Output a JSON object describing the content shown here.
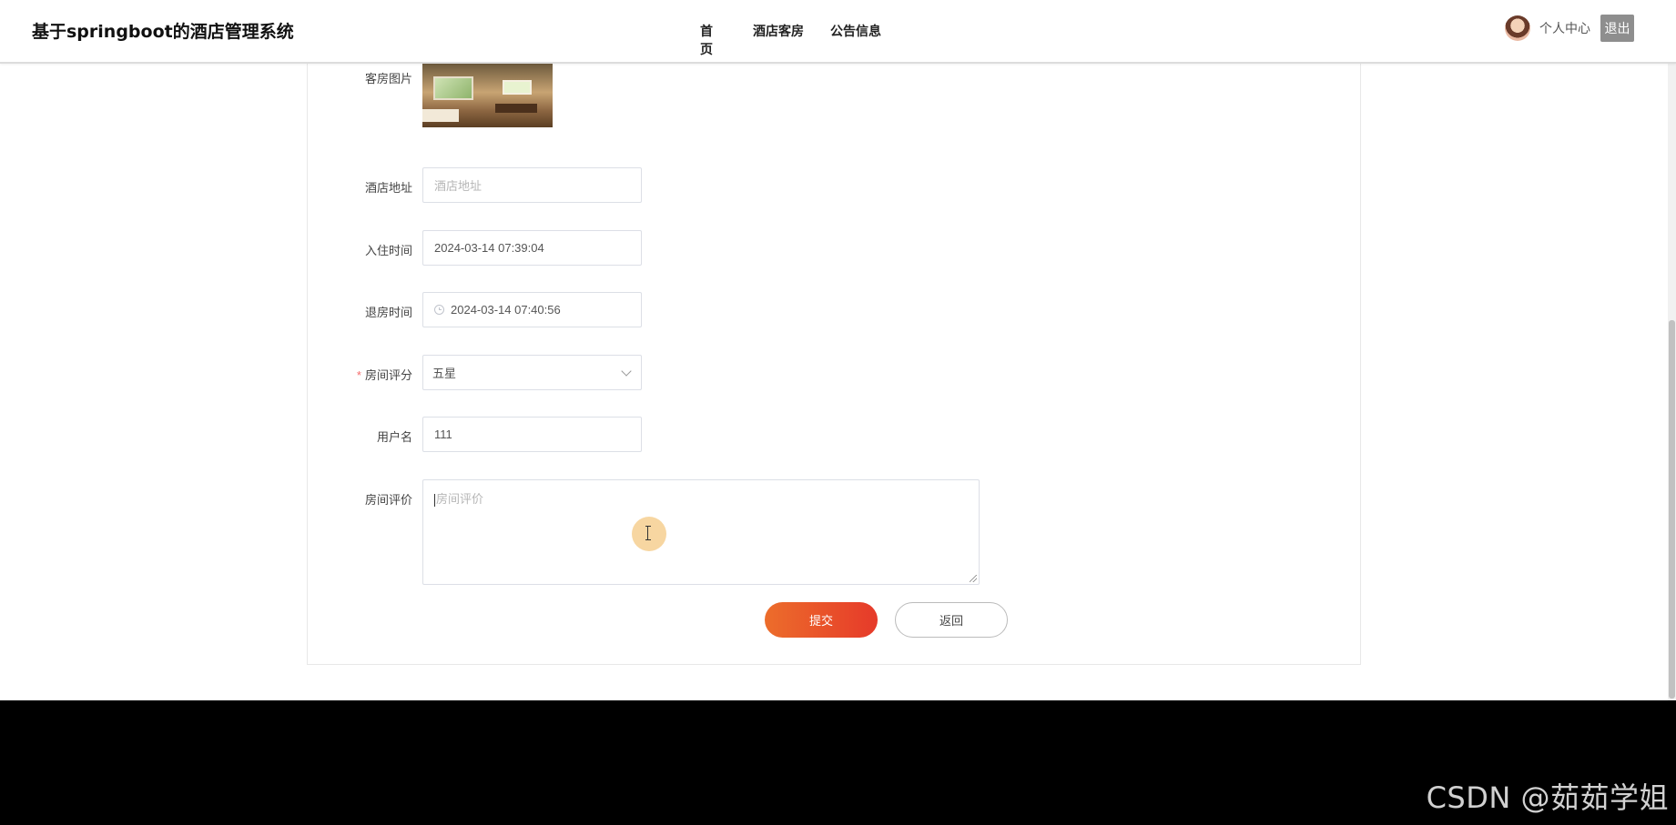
{
  "header": {
    "brand": "基于springboot的酒店管理系统",
    "nav": [
      {
        "label": "首页"
      },
      {
        "label": "酒店客房"
      },
      {
        "label": "公告信息"
      }
    ],
    "user_center": "个人中心",
    "logout": "退出"
  },
  "form": {
    "room_image_label": "客房图片",
    "hotel_address": {
      "label": "酒店地址",
      "placeholder": "酒店地址",
      "value": ""
    },
    "checkin_time": {
      "label": "入住时间",
      "value": "2024-03-14 07:39:04"
    },
    "checkout_time": {
      "label": "退房时间",
      "value": "2024-03-14 07:40:56"
    },
    "room_rating": {
      "label": "房间评分",
      "value": "五星",
      "required_mark": "*"
    },
    "username": {
      "label": "用户名",
      "value": "111"
    },
    "room_review": {
      "label": "房间评价",
      "placeholder": "房间评价"
    },
    "submit_label": "提交",
    "back_label": "返回"
  },
  "watermark": "CSDN @茹茹学姐",
  "colors": {
    "accent_start": "#ec6d2b",
    "accent_end": "#e63a2a",
    "footer": "#000000"
  }
}
